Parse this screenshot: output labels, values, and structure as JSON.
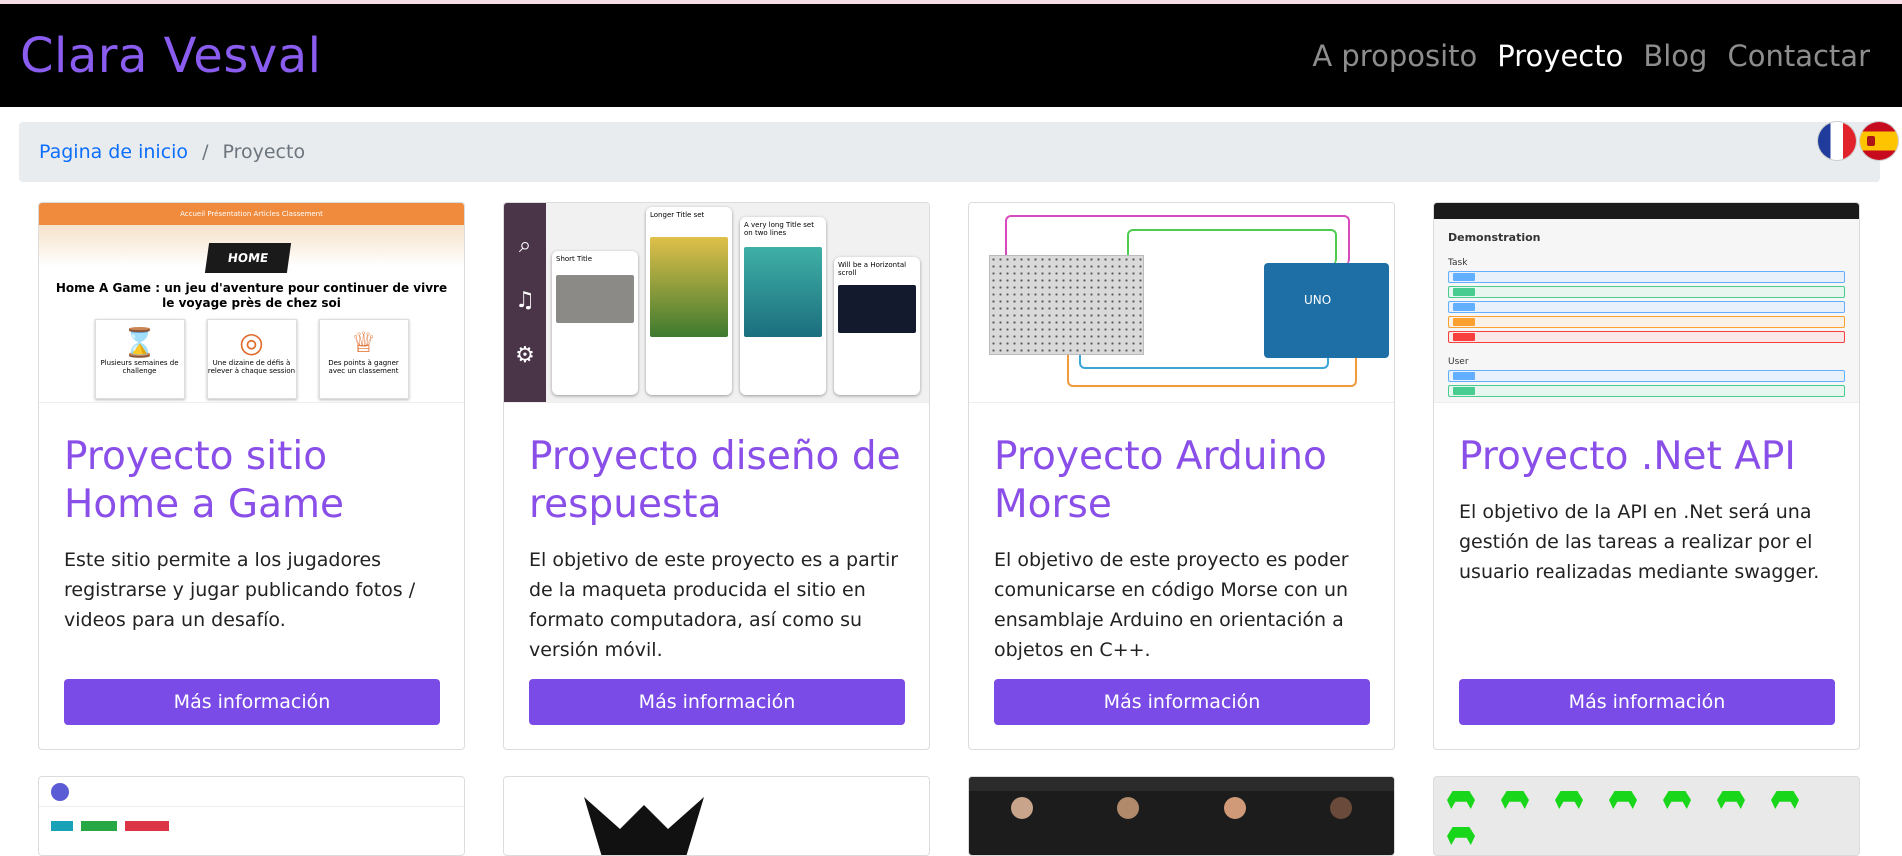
{
  "brand": "Clara Vesval",
  "nav": {
    "items": [
      {
        "label": "A proposito",
        "active": false
      },
      {
        "label": "Proyecto",
        "active": true
      },
      {
        "label": "Blog",
        "active": false
      },
      {
        "label": "Contactar",
        "active": false
      }
    ]
  },
  "breadcrumb": {
    "home": "Pagina de inicio",
    "separator": "/",
    "current": "Proyecto"
  },
  "languages": [
    "flag-france",
    "flag-spain"
  ],
  "projects": [
    {
      "title": "Proyecto sitio Home a Game",
      "text": "Este sitio permite a los jugadores registrarse y jugar publicando fotos / videos para un desafío.",
      "button": "Más información",
      "thumb": {
        "nav": "Accueil   Présentation   Articles   Classement",
        "logo": "HOME",
        "headline": "Home A Game : un jeu d'aventure pour continuer de vivre le voyage près de chez soi",
        "boxes": [
          "Plusieurs semaines de challenge",
          "Une dizaine de défis à relever à chaque session",
          "Des points à gagner avec un classement"
        ]
      }
    },
    {
      "title": "Proyecto diseño de respuesta",
      "text": "El objetivo de este proyecto es a partir de la maqueta producida el sitio en formato computadora, así como su versión móvil.",
      "button": "Más información",
      "thumb": {
        "cards": [
          "Short Title",
          "Longer Title set",
          "A very long Title set on two lines",
          "Will be a Horizontal scroll"
        ]
      }
    },
    {
      "title": "Proyecto Arduino Morse",
      "text": "El objetivo de este proyecto es poder comunicarse en código Morse con un ensamblaje Arduino en orientación a objetos en C++.",
      "button": "Más información"
    },
    {
      "title": "Proyecto .Net API",
      "text": "El objetivo de la API en .Net será una gestión de las tareas a realizar por el usuario realizadas mediante swagger.",
      "button": "Más información",
      "thumb": {
        "heading": "Demonstration",
        "sections": [
          "Task",
          "User"
        ]
      }
    }
  ],
  "colors": {
    "brand": "#8a5cf0",
    "navbar": "#000000",
    "button": "#7a4be7",
    "title": "#8a4fe8",
    "breadcrumb_bg": "#e9ecef",
    "link": "#0d6efd"
  }
}
